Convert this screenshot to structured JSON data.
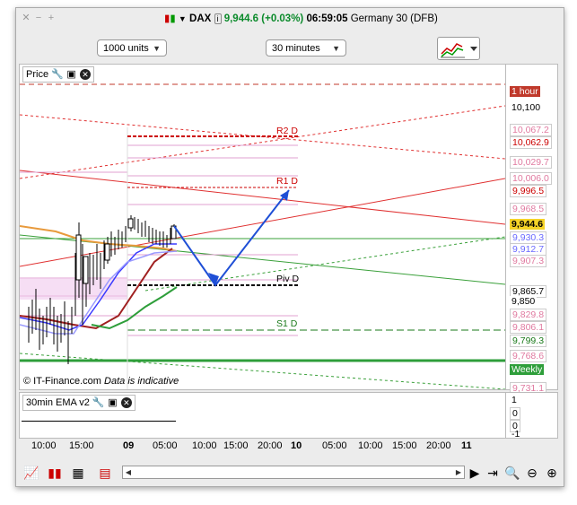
{
  "window": {
    "title_symbol": "DAX",
    "title_price": "9,944.6 (+0.03%)",
    "title_time": "06:59:05",
    "title_market": "Germany 30 (DFB)"
  },
  "toolbar": {
    "units": "1000 units",
    "interval": "30 minutes"
  },
  "price_pane": {
    "title": "Price",
    "watermark_source": "© IT-Finance.com",
    "watermark_note": "Data is indicative",
    "levels": [
      {
        "label": "R2 D",
        "color": "#cc0000"
      },
      {
        "label": "R1 D",
        "color": "#cc0000"
      },
      {
        "label": "Piv D",
        "color": "#000000"
      },
      {
        "label": "S1 D",
        "color": "#1a7a1a"
      }
    ],
    "axis_labels": [
      {
        "text": "1 hour",
        "bg": "#c0392b",
        "fg": "#ffffff"
      },
      {
        "text": "10,100",
        "bg": "#ffffff",
        "fg": "#000000"
      },
      {
        "text": "10,067.2",
        "bg": "#ffffff",
        "fg": "#e07aa0"
      },
      {
        "text": "10,062.9",
        "bg": "#ffffff",
        "fg": "#cc0000"
      },
      {
        "text": "10,029.7",
        "bg": "#ffffff",
        "fg": "#e07aa0"
      },
      {
        "text": "10,006.0",
        "bg": "#ffffff",
        "fg": "#e07aa0"
      },
      {
        "text": "9,996.5",
        "bg": "#ffffff",
        "fg": "#cc0000"
      },
      {
        "text": "9,968.5",
        "bg": "#ffffff",
        "fg": "#e07aa0"
      },
      {
        "text": "9,944.6",
        "bg": "#f5d327",
        "fg": "#000000"
      },
      {
        "text": "9,930.3",
        "bg": "#ffffff",
        "fg": "#6a6aff"
      },
      {
        "text": "9,912.7",
        "bg": "#ffffff",
        "fg": "#6a6aff"
      },
      {
        "text": "9,907.3",
        "bg": "#ffffff",
        "fg": "#e07aa0"
      },
      {
        "text": "9,865.7",
        "bg": "#ffffff",
        "fg": "#000000"
      },
      {
        "text": "9,850",
        "bg": "#ffffff",
        "fg": "#000000"
      },
      {
        "text": "9,829.8",
        "bg": "#ffffff",
        "fg": "#e07aa0"
      },
      {
        "text": "9,806.1",
        "bg": "#ffffff",
        "fg": "#e07aa0"
      },
      {
        "text": "9,799.3",
        "bg": "#ffffff",
        "fg": "#1a7a1a"
      },
      {
        "text": "9,768.6",
        "bg": "#ffffff",
        "fg": "#e07aa0"
      },
      {
        "text": "Weekly",
        "bg": "#2e9e3a",
        "fg": "#ffffff"
      },
      {
        "text": "9,731.1",
        "bg": "#ffffff",
        "fg": "#e07aa0"
      }
    ]
  },
  "indicator_pane": {
    "title": "30min EMA v2",
    "axis_labels": [
      "1",
      "0",
      "0",
      "-1"
    ]
  },
  "x_axis": {
    "ticks": [
      "10:00",
      "15:00",
      "09",
      "05:00",
      "10:00",
      "15:00",
      "20:00",
      "10",
      "05:00",
      "10:00",
      "15:00",
      "20:00",
      "11"
    ]
  },
  "colors": {
    "support": "#2e9e3a",
    "resistance": "#e03030",
    "forecast": "#1f4fd6",
    "highlight": "#f5d327"
  }
}
